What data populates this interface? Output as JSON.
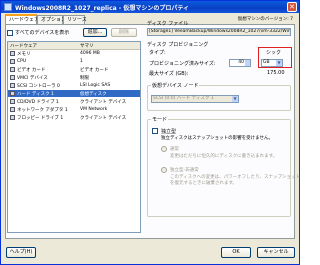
{
  "window": {
    "title": "Windows2008R2_1027_replica - 仮想マシンのプロパティ"
  },
  "tabs": [
    {
      "label": "ハードウェア"
    },
    {
      "label": "オプション"
    },
    {
      "label": "リソース"
    }
  ],
  "vm_version": "仮想マシンのバージョン: 7",
  "show_all_devices": {
    "label": "すべてのデバイスを表示",
    "checked": false
  },
  "buttons": {
    "add": "追加...",
    "remove": "削除",
    "help": "ヘルプ(H)",
    "ok": "OK",
    "cancel": "キャンセル"
  },
  "hardware": {
    "columns": [
      "ハードウェア",
      "サマリ"
    ],
    "rows": [
      {
        "name": "メモリ",
        "summary": "4096 MB",
        "icon": "memory-icon"
      },
      {
        "name": "CPU",
        "summary": "1",
        "icon": "cpu-icon"
      },
      {
        "name": "ビデオ カード",
        "summary": "ビデオ カード",
        "icon": "video-card-icon"
      },
      {
        "name": "VMCI デバイス",
        "summary": "制限",
        "icon": "vmci-icon"
      },
      {
        "name": "SCSI コントローラ 0",
        "summary": "LSI Logic SAS",
        "icon": "scsi-controller-icon"
      },
      {
        "name": "ハード ディスク 1",
        "summary": "仮想ディスク",
        "icon": "hard-disk-icon",
        "selected": true
      },
      {
        "name": "CD/DVD ドライブ 1",
        "summary": "クライアント デバイス",
        "icon": "cd-dvd-icon"
      },
      {
        "name": "ネットワーク アダプタ 1",
        "summary": "VM Network",
        "icon": "network-adapter-icon"
      },
      {
        "name": "フロッピー ドライブ 1",
        "summary": "クライアント デバイス",
        "icon": "floppy-icon"
      }
    ]
  },
  "disk_file": {
    "label": "ディスク ファイル",
    "value": "[Storage1] VeeamBackup/Windows2008R2_1027/vm-3322/Windows..."
  },
  "disk_provisioning": {
    "label": "ディスク プロビジョニング",
    "type_label": "タイプ:",
    "type_value": "シック",
    "size_label": "プロビジョニング済みサイズ:",
    "size_value": "40",
    "size_unit": "GB",
    "max_size_label": "最大サイズ (GB):",
    "max_size_value": "175.00"
  },
  "virtual_device_node": {
    "label": "仮想デバイス ノード",
    "value": "SCSI (0:0) ハード ディスク 1"
  },
  "mode": {
    "label": "モード",
    "independent_label": "独立型",
    "independent_desc": "独立ディスクはスナップショットの影響を受けません。",
    "persistent_label": "通常",
    "persistent_desc": "変更はただちに恒久的にディスクに書き込まれます。",
    "nonpersistent_label": "独立型-非通常",
    "nonpersistent_desc_1": "このディスクへの変更は、パワーオフしたり、スナップショット",
    "nonpersistent_desc_2": "を復元するときに破棄されます。"
  }
}
